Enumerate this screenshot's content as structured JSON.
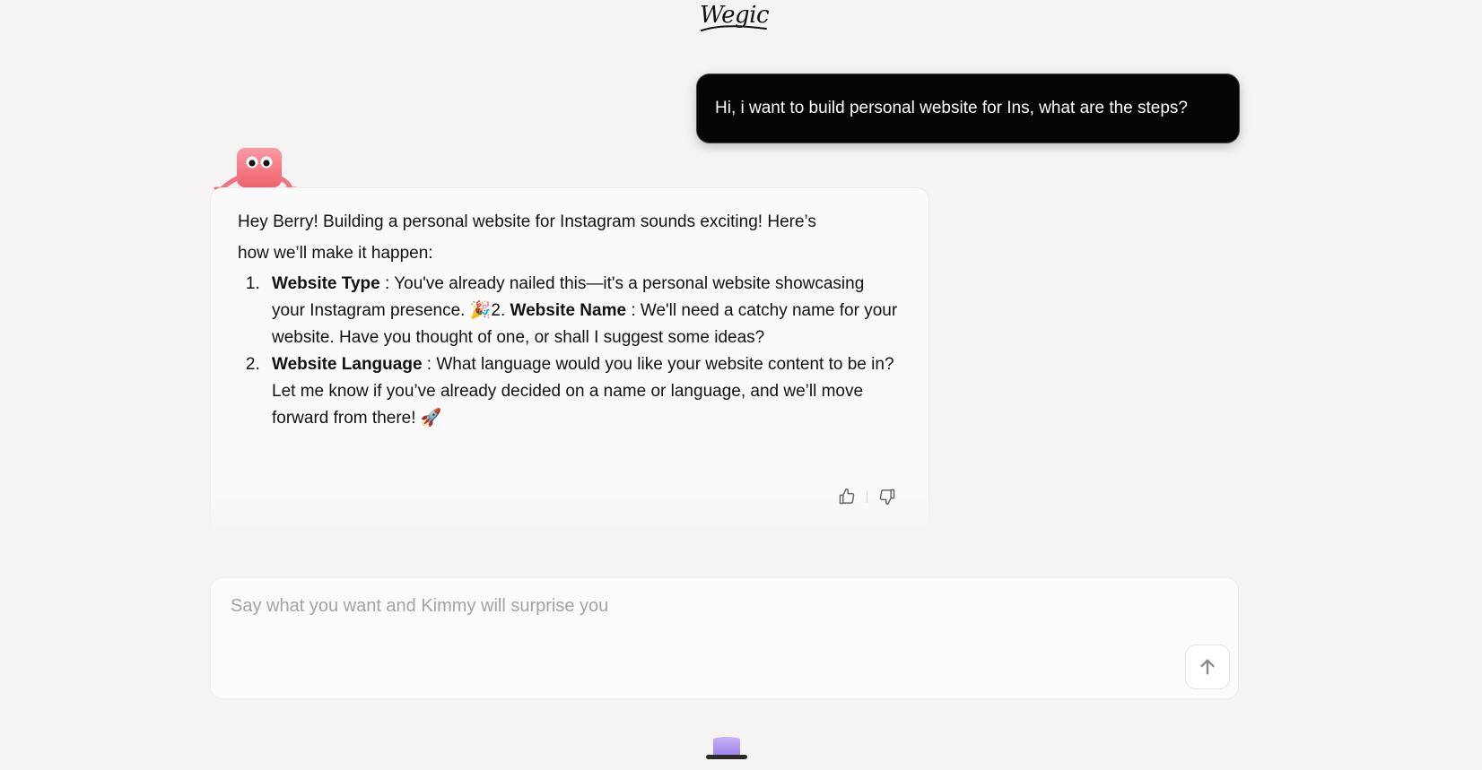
{
  "header": {
    "logo_text": "Wegic"
  },
  "conversation": {
    "user_message": "Hi, i want to build personal website for Ins, what are the steps?",
    "assistant": {
      "intro_line1": "Hey Berry! Building a personal website for Instagram sounds exciting! Here’s",
      "intro_line2": "how we’ll make it happen:",
      "step1_title": "Website Type",
      "step1_text": ": You've already nailed this—it's a personal website showcasing your Instagram presence. 🎉2.",
      "step1b_title": "Website Name",
      "step1b_text": ": We'll need a catchy name for your website. Have you thought of one, or shall I suggest some ideas?",
      "step2_title": "Website Language",
      "step2_text": ": What language would you like your website content to be in?Let me know if you’ve already decided on a name or language, and we’ll move forward from there! 🚀",
      "feedback": {
        "like_icon": "thumbs-up-icon",
        "dislike_icon": "thumbs-down-icon"
      }
    }
  },
  "composer": {
    "placeholder": "Say what you want and Kimmy will surprise you",
    "value": "",
    "send_icon": "arrow-up-icon"
  },
  "colors": {
    "background": "#f5f4f2",
    "user_bubble": "#050505",
    "mascot_pink": "#f57a86",
    "bottom_mascot_purple": "#b9a4f2"
  }
}
